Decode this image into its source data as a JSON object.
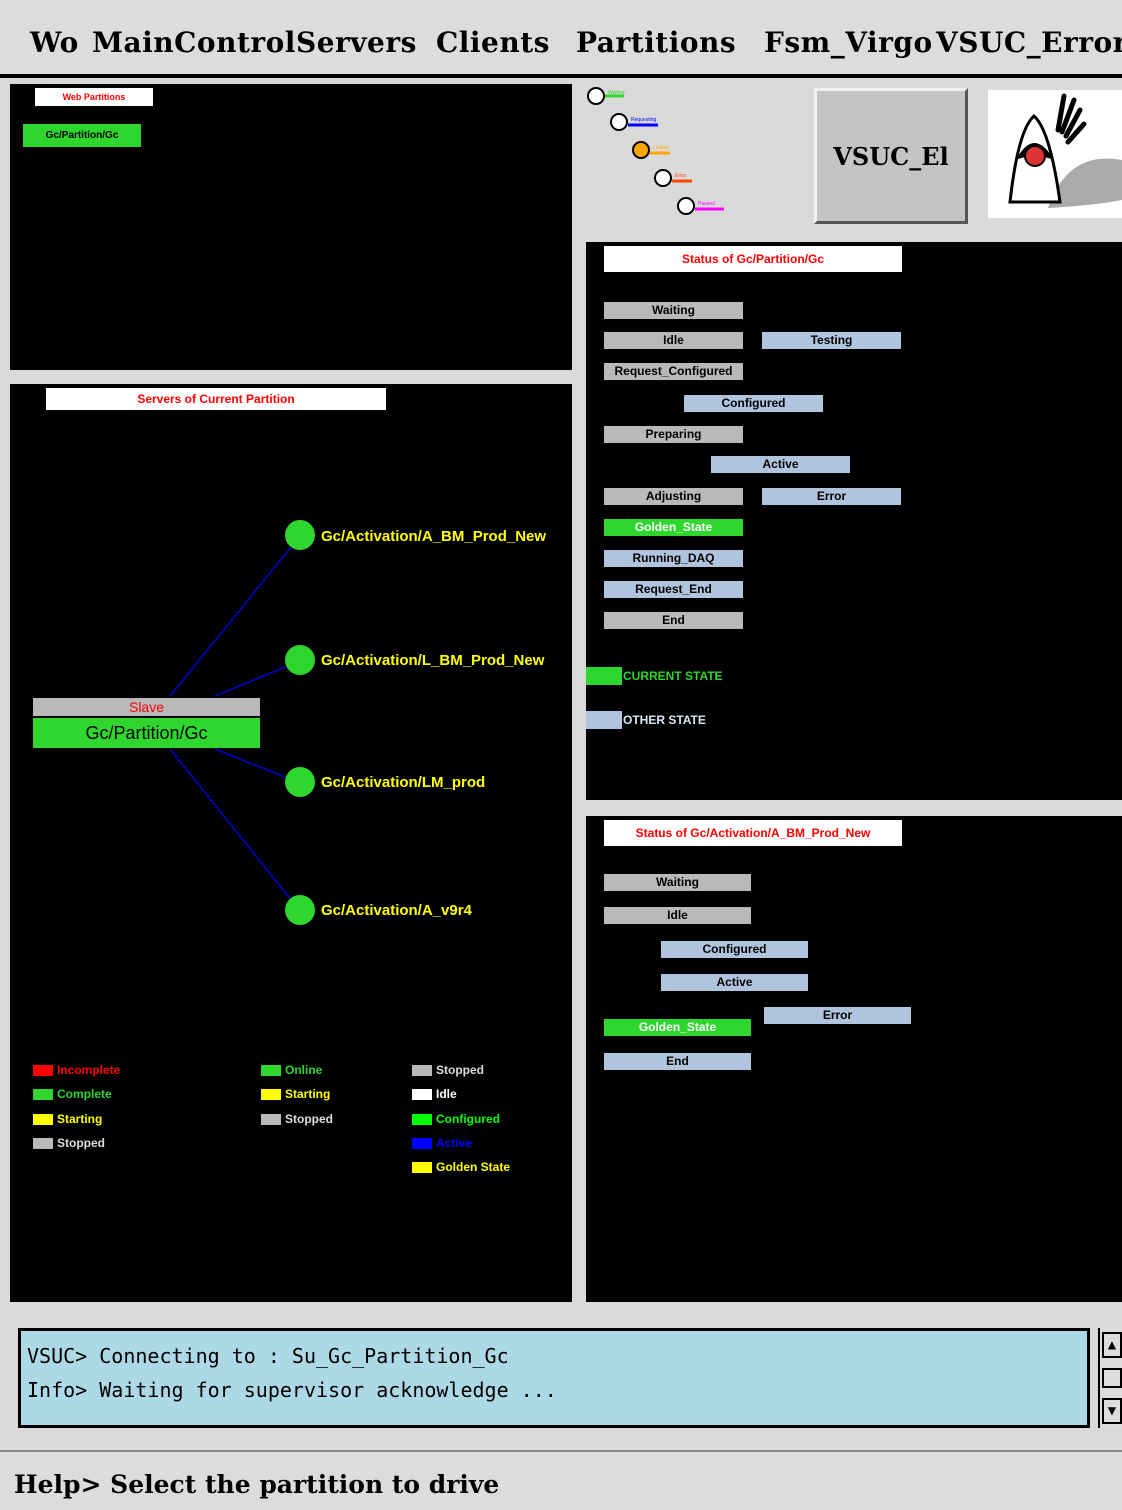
{
  "menu": [
    "Wo",
    "MainControl",
    "Servers",
    "Clients",
    "Partitions",
    "Fsm_Virgo",
    "VSUC_Error"
  ],
  "web_partitions": {
    "title": "Web Partitions",
    "items": [
      "Gc/Partition/Gc"
    ]
  },
  "fsm_diagram": {
    "labels": [
      "Waiting",
      "Requesting",
      "Locked",
      "Error",
      "Paused"
    ]
  },
  "vsuc_button": "VSUC_El",
  "servers_panel": {
    "title": "Servers of Current Partition",
    "master": {
      "role": "Slave",
      "name": "Gc/Partition/Gc"
    },
    "nodes": [
      "Gc/Activation/A_BM_Prod_New",
      "Gc/Activation/L_BM_Prod_New",
      "Gc/Activation/LM_prod",
      "Gc/Activation/A_v9r4"
    ]
  },
  "legend": {
    "col1": [
      {
        "label": "Incomplete",
        "color": "#ff0000",
        "text_color": "#ff0000"
      },
      {
        "label": "Complete",
        "color": "#2ed62e",
        "text_color": "#2ed62e"
      },
      {
        "label": "Starting",
        "color": "#ffff00",
        "text_color": "#ffff00"
      },
      {
        "label": "Stopped",
        "color": "#b9b9b9",
        "text_color": "#dddddd"
      }
    ],
    "col2": [
      {
        "label": "Online",
        "color": "#2ed62e",
        "text_color": "#2ed62e"
      },
      {
        "label": "Starting",
        "color": "#ffff00",
        "text_color": "#ffff00"
      },
      {
        "label": "Stopped",
        "color": "#b9b9b9",
        "text_color": "#dddddd"
      }
    ],
    "col3": [
      {
        "label": "Stopped",
        "color": "#b9b9b9",
        "text_color": "#dddddd"
      },
      {
        "label": "Idle",
        "color": "#ffffff",
        "text_color": "#ffffff"
      },
      {
        "label": "Configured",
        "color": "#00ff00",
        "text_color": "#00ff00"
      },
      {
        "label": "Active",
        "color": "#0000ff",
        "text_color": "#0000ff"
      },
      {
        "label": "Golden State",
        "color": "#ffff00",
        "text_color": "#ffff00"
      }
    ]
  },
  "partition_status": {
    "title": "Status of Gc/Partition/Gc",
    "states": {
      "waiting": "Waiting",
      "idle": "Idle",
      "testing": "Testing",
      "request_configured": "Request_Configured",
      "configured": "Configured",
      "preparing": "Preparing",
      "active": "Active",
      "adjusting": "Adjusting",
      "error": "Error",
      "golden_state": "Golden_State",
      "running_daq": "Running_DAQ",
      "request_end": "Request_End",
      "end": "End"
    },
    "legend_current": "CURRENT STATE",
    "legend_other": "OTHER STATE"
  },
  "activation_status": {
    "title": "Status of Gc/Activation/A_BM_Prod_New",
    "states": {
      "waiting": "Waiting",
      "idle": "Idle",
      "configured": "Configured",
      "active": "Active",
      "error": "Error",
      "golden_state": "Golden_State",
      "end": "End"
    }
  },
  "console": {
    "lines": [
      "VSUC> Connecting to : Su_Gc_Partition_Gc",
      "Info> Waiting for supervisor acknowledge ..."
    ]
  },
  "help_text": "Help> Select the partition to drive",
  "colors": {
    "current_state": "#2ed62e",
    "other_state": "#b0c4de",
    "node": "#2ed62e",
    "console_bg": "#add8e6"
  }
}
